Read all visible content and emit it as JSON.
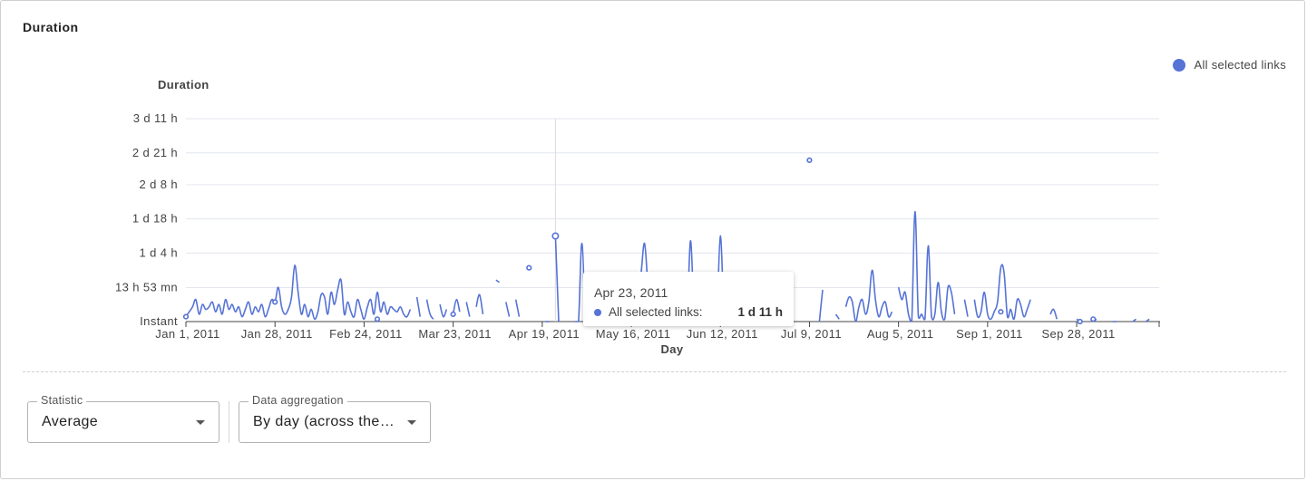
{
  "panel": {
    "title": "Duration"
  },
  "legend": {
    "label": "All selected links"
  },
  "colors": {
    "series": "#5673d6",
    "grid": "#e3e6ef"
  },
  "chart_data": {
    "type": "line",
    "title": "",
    "ylabel": "Duration",
    "xlabel": "Day",
    "y_unit": "hours",
    "ylim": [
      0,
      83
    ],
    "yticks": [
      {
        "value": 0,
        "label": "Instant"
      },
      {
        "value": 13.88,
        "label": "13 h 53 mn"
      },
      {
        "value": 28,
        "label": "1 d 4 h"
      },
      {
        "value": 42,
        "label": "1 d 18 h"
      },
      {
        "value": 56,
        "label": "2 d 8 h"
      },
      {
        "value": 69,
        "label": "2 d 21 h"
      },
      {
        "value": 83,
        "label": "3 d 11 h"
      }
    ],
    "xlim": [
      "2011-01-01",
      "2011-10-23"
    ],
    "xticks": [
      "Jan 1, 2011",
      "Jan 28, 2011",
      "Feb 24, 2011",
      "Mar 23, 2011",
      "Apr 19, 2011",
      "May 16, 2011",
      "Jun 12, 2011",
      "Jul 9, 2011",
      "Aug 5, 2011",
      "Sep 1, 2011",
      "Sep 28, 2011"
    ],
    "grid": true,
    "legend_position": "top-right",
    "series": [
      {
        "name": "All selected links",
        "points": [
          [
            "2011-01-01",
            2
          ],
          [
            "2011-01-02",
            4
          ],
          [
            "2011-01-03",
            6
          ],
          [
            "2011-01-04",
            9
          ],
          [
            "2011-01-05",
            3
          ],
          [
            "2011-01-06",
            7
          ],
          [
            "2011-01-07",
            5
          ],
          [
            "2011-01-08",
            6
          ],
          [
            "2011-01-09",
            8
          ],
          [
            "2011-01-10",
            4
          ],
          [
            "2011-01-11",
            7
          ],
          [
            "2011-01-12",
            3
          ],
          [
            "2011-01-13",
            9
          ],
          [
            "2011-01-14",
            5
          ],
          [
            "2011-01-15",
            7
          ],
          [
            "2011-01-16",
            4
          ],
          [
            "2011-01-17",
            6
          ],
          [
            "2011-01-18",
            2
          ],
          [
            "2011-01-19",
            5
          ],
          [
            "2011-01-20",
            8
          ],
          [
            "2011-01-21",
            3
          ],
          [
            "2011-01-22",
            6
          ],
          [
            "2011-01-23",
            4
          ],
          [
            "2011-01-24",
            7
          ],
          [
            "2011-01-25",
            2
          ],
          [
            "2011-01-26",
            5
          ],
          [
            "2011-01-27",
            9
          ],
          [
            "2011-01-28",
            8
          ],
          [
            "2011-01-29",
            14
          ],
          [
            "2011-01-30",
            6
          ],
          [
            "2011-01-31",
            3
          ],
          [
            "2011-02-01",
            5
          ],
          [
            "2011-02-02",
            10
          ],
          [
            "2011-02-03",
            23
          ],
          [
            "2011-02-04",
            12
          ],
          [
            "2011-02-05",
            3
          ],
          [
            "2011-02-06",
            7
          ],
          [
            "2011-02-07",
            2
          ],
          [
            "2011-02-08",
            5
          ],
          [
            "2011-02-09",
            1
          ],
          [
            "2011-02-10",
            4
          ],
          [
            "2011-02-11",
            11
          ],
          [
            "2011-02-12",
            10
          ],
          [
            "2011-02-13",
            3
          ],
          [
            "2011-02-14",
            12
          ],
          [
            "2011-02-15",
            7
          ],
          [
            "2011-02-16",
            13
          ],
          [
            "2011-02-17",
            17
          ],
          [
            "2011-02-18",
            3
          ],
          [
            "2011-02-19",
            8
          ],
          [
            "2011-02-20",
            4
          ],
          [
            "2011-02-21",
            2
          ],
          [
            "2011-02-22",
            9
          ],
          [
            "2011-02-23",
            5
          ],
          [
            "2011-02-24",
            1
          ],
          [
            "2011-02-25",
            6
          ],
          [
            "2011-02-26",
            9
          ],
          [
            "2011-02-27",
            3
          ],
          [
            "2011-02-28",
            12
          ],
          [
            "2011-03-01",
            4
          ],
          [
            "2011-03-02",
            8
          ],
          [
            "2011-03-03",
            3
          ],
          [
            "2011-03-04",
            6
          ],
          [
            "2011-03-05",
            5
          ],
          [
            "2011-03-06",
            4
          ],
          [
            "2011-03-07",
            6
          ],
          [
            "2011-03-08",
            3
          ],
          [
            "2011-03-09",
            2
          ],
          [
            "2011-03-10",
            5
          ],
          [
            "2011-03-11",
            null
          ],
          [
            "2011-03-12",
            10
          ],
          [
            "2011-03-13",
            2
          ],
          [
            "2011-03-14",
            null
          ],
          [
            "2011-03-15",
            9
          ],
          [
            "2011-03-16",
            3
          ],
          [
            "2011-03-17",
            1
          ],
          [
            "2011-03-18",
            null
          ],
          [
            "2011-03-19",
            7
          ],
          [
            "2011-03-20",
            2
          ],
          [
            "2011-03-21",
            5
          ],
          [
            "2011-03-22",
            null
          ],
          [
            "2011-03-23",
            3
          ],
          [
            "2011-03-24",
            9
          ],
          [
            "2011-03-25",
            4
          ],
          [
            "2011-03-26",
            null
          ],
          [
            "2011-03-27",
            8
          ],
          [
            "2011-03-28",
            2
          ],
          [
            "2011-03-29",
            null
          ],
          [
            "2011-03-30",
            6
          ],
          [
            "2011-03-31",
            11
          ],
          [
            "2011-04-01",
            3
          ],
          [
            "2011-04-02",
            null
          ],
          [
            "2011-04-03",
            9
          ],
          [
            "2011-04-04",
            null
          ],
          [
            "2011-04-05",
            17
          ],
          [
            "2011-04-06",
            16
          ],
          [
            "2011-04-07",
            null
          ],
          [
            "2011-04-08",
            8
          ],
          [
            "2011-04-09",
            2
          ],
          [
            "2011-04-10",
            null
          ],
          [
            "2011-04-11",
            9
          ],
          [
            "2011-04-12",
            2
          ],
          [
            "2011-04-13",
            null
          ],
          [
            "2011-04-14",
            null
          ],
          [
            "2011-04-15",
            22
          ],
          [
            "2011-04-16",
            null
          ],
          [
            "2011-04-17",
            null
          ],
          [
            "2011-04-18",
            null
          ],
          [
            "2011-04-19",
            null
          ],
          [
            "2011-04-20",
            0
          ],
          [
            "2011-04-21",
            0
          ],
          [
            "2011-04-22",
            null
          ],
          [
            "2011-04-23",
            35
          ],
          [
            "2011-04-24",
            0
          ],
          [
            "2011-04-25",
            null
          ],
          [
            "2011-04-26",
            null
          ],
          [
            "2011-04-27",
            null
          ],
          [
            "2011-04-28",
            null
          ],
          [
            "2011-04-29",
            0
          ],
          [
            "2011-04-30",
            0
          ],
          [
            "2011-05-01",
            32
          ],
          [
            "2011-05-02",
            0
          ],
          [
            "2011-05-10",
            0
          ],
          [
            "2011-05-11",
            6
          ],
          [
            "2011-05-12",
            2
          ],
          [
            "2011-05-18",
            6
          ],
          [
            "2011-05-19",
            20
          ],
          [
            "2011-05-20",
            32
          ],
          [
            "2011-05-21",
            16
          ],
          [
            "2011-05-22",
            4
          ],
          [
            "2011-06-01",
            0
          ],
          [
            "2011-06-02",
            6
          ],
          [
            "2011-06-03",
            33
          ],
          [
            "2011-06-04",
            0
          ],
          [
            "2011-06-07",
            8
          ],
          [
            "2011-06-08",
            2
          ],
          [
            "2011-06-11",
            0
          ],
          [
            "2011-06-12",
            35
          ],
          [
            "2011-06-13",
            2
          ],
          [
            "2011-07-01",
            13
          ],
          [
            "2011-07-02",
            4
          ],
          [
            "2011-07-03",
            0
          ],
          [
            "2011-07-08",
            null
          ],
          [
            "2011-07-09",
            66
          ],
          [
            "2011-07-10",
            null
          ],
          [
            "2011-07-12",
            0
          ],
          [
            "2011-07-13",
            13
          ],
          [
            "2011-07-17",
            3
          ],
          [
            "2011-07-18",
            1
          ],
          [
            "2011-07-20",
            6
          ],
          [
            "2011-07-21",
            10
          ],
          [
            "2011-07-22",
            8
          ],
          [
            "2011-07-23",
            0
          ],
          [
            "2011-07-24",
            6
          ],
          [
            "2011-07-25",
            9
          ],
          [
            "2011-07-26",
            3
          ],
          [
            "2011-07-27",
            8
          ],
          [
            "2011-07-28",
            21
          ],
          [
            "2011-07-29",
            9
          ],
          [
            "2011-07-30",
            2
          ],
          [
            "2011-07-31",
            6
          ],
          [
            "2011-08-01",
            8
          ],
          [
            "2011-08-02",
            2
          ],
          [
            "2011-08-03",
            4
          ],
          [
            "2011-08-05",
            14
          ],
          [
            "2011-08-06",
            9
          ],
          [
            "2011-08-07",
            12
          ],
          [
            "2011-08-08",
            3
          ],
          [
            "2011-08-09",
            0
          ],
          [
            "2011-08-10",
            45
          ],
          [
            "2011-08-11",
            2
          ],
          [
            "2011-08-12",
            3
          ],
          [
            "2011-08-13",
            1
          ],
          [
            "2011-08-14",
            31
          ],
          [
            "2011-08-15",
            2
          ],
          [
            "2011-08-16",
            3
          ],
          [
            "2011-08-17",
            16
          ],
          [
            "2011-08-18",
            4
          ],
          [
            "2011-08-19",
            1
          ],
          [
            "2011-08-20",
            14
          ],
          [
            "2011-08-21",
            12
          ],
          [
            "2011-08-22",
            3
          ],
          [
            "2011-08-25",
            9
          ],
          [
            "2011-08-26",
            2
          ],
          [
            "2011-08-27",
            null
          ],
          [
            "2011-08-28",
            9
          ],
          [
            "2011-08-29",
            2
          ],
          [
            "2011-08-30",
            4
          ],
          [
            "2011-08-31",
            12
          ],
          [
            "2011-09-01",
            3
          ],
          [
            "2011-09-02",
            1
          ],
          [
            "2011-09-03",
            4
          ],
          [
            "2011-09-04",
            8
          ],
          [
            "2011-09-05",
            22
          ],
          [
            "2011-09-06",
            20
          ],
          [
            "2011-09-07",
            2
          ],
          [
            "2011-09-08",
            5
          ],
          [
            "2011-09-09",
            1
          ],
          [
            "2011-09-10",
            9
          ],
          [
            "2011-09-11",
            7
          ],
          [
            "2011-09-12",
            2
          ],
          [
            "2011-09-13",
            5
          ],
          [
            "2011-09-14",
            9
          ],
          [
            "2011-09-20",
            3
          ],
          [
            "2011-09-21",
            5
          ],
          [
            "2011-09-22",
            1
          ],
          [
            "2011-09-28",
            1
          ],
          [
            "2011-09-29",
            0
          ],
          [
            "2011-10-03",
            0
          ],
          [
            "2011-10-04",
            1
          ],
          [
            "2011-10-09",
            0
          ],
          [
            "2011-10-10",
            0
          ],
          [
            "2011-10-15",
            0
          ],
          [
            "2011-10-16",
            1
          ],
          [
            "2011-10-19",
            0
          ],
          [
            "2011-10-20",
            1
          ],
          [
            "2011-10-22",
            0
          ]
        ]
      }
    ],
    "markers": [
      {
        "x": "2011-01-01",
        "y": 2
      },
      {
        "x": "2011-01-28",
        "y": 8
      },
      {
        "x": "2011-02-28",
        "y": 1
      },
      {
        "x": "2011-03-23",
        "y": 3
      },
      {
        "x": "2011-04-15",
        "y": 22
      },
      {
        "x": "2011-04-23",
        "y": 35
      },
      {
        "x": "2011-07-09",
        "y": 66
      },
      {
        "x": "2011-09-05",
        "y": 4
      },
      {
        "x": "2011-09-29",
        "y": 0
      },
      {
        "x": "2011-10-03",
        "y": 1
      }
    ],
    "hover": {
      "x": "2011-04-23"
    }
  },
  "tooltip": {
    "date": "Apr 23, 2011",
    "series_label": "All selected links:",
    "value": "1 d 11 h"
  },
  "controls": {
    "statistic": {
      "label": "Statistic",
      "value": "Average"
    },
    "aggregation": {
      "label": "Data aggregation",
      "value": "By day (across the…"
    }
  }
}
